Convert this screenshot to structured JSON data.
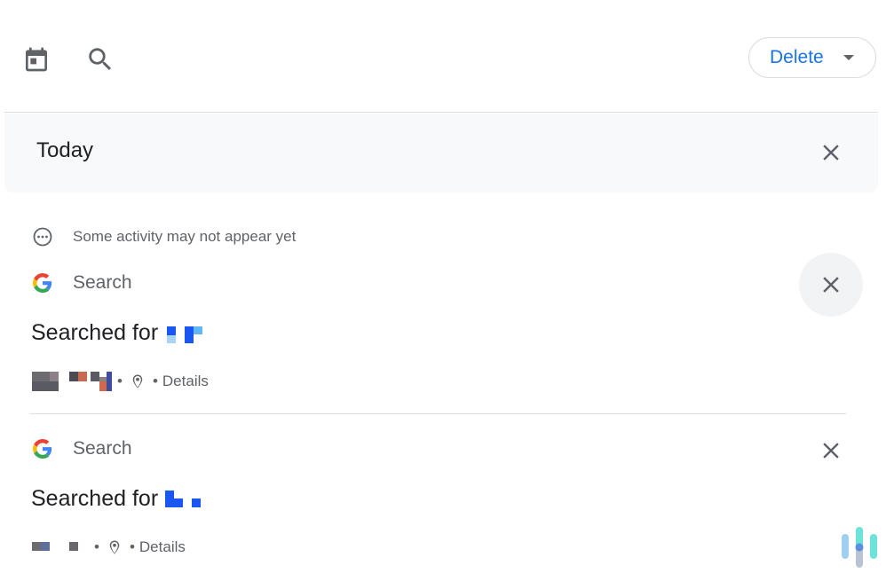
{
  "toolbar": {
    "calendar_icon": "calendar-today-icon",
    "search_icon": "search-icon",
    "delete_label": "Delete",
    "delete_caret_icon": "arrow-drop-down-icon",
    "accent_color": "#1a73e8"
  },
  "day_group": {
    "title": "Today",
    "close_icon": "close-icon"
  },
  "notice": {
    "icon": "more-horiz-circle-icon",
    "text": "Some activity may not appear yet"
  },
  "activities": [
    {
      "service_icon": "google-g-icon",
      "service": "Search",
      "action": "Searched for",
      "separator1": "•",
      "location_icon": "location-pin-icon",
      "separator2": "•",
      "details_label": "Details",
      "close_icon": "close-icon"
    },
    {
      "service_icon": "google-g-icon",
      "service": "Search",
      "action": "Searched for",
      "separator1": "•",
      "location_icon": "location-pin-icon",
      "separator2": "•",
      "details_label": "Details",
      "close_icon": "close-icon"
    }
  ],
  "google_letter": "G"
}
